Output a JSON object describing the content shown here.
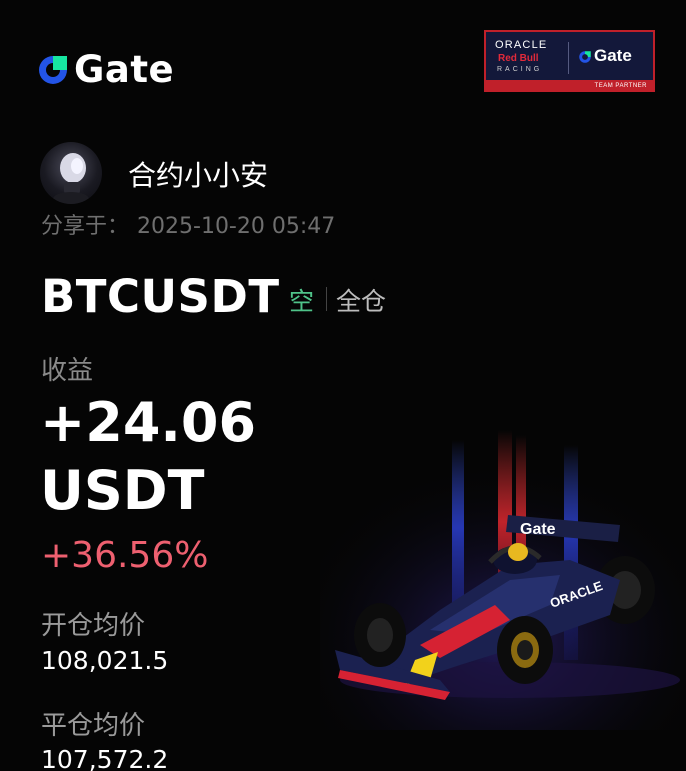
{
  "brand": {
    "logo_text": "Gate",
    "logo_icon": "gate-logo-icon",
    "accent_color": "#2354e6",
    "accent_green": "#17e6a1"
  },
  "partner_badge": {
    "oracle": "ORACLE",
    "red_bull": "Red Bull",
    "racing": "RACING",
    "gate": "Gate",
    "team_partner": "TEAM PARTNER"
  },
  "user": {
    "name": "合约小小安",
    "share_label": "分享于：",
    "share_time": "2025-10-20 05:47"
  },
  "position": {
    "pair": "BTCUSDT",
    "side": "空",
    "margin_mode": "全仓",
    "side_color": "#4fc389"
  },
  "pnl": {
    "label": "收益",
    "value": "+24.06",
    "unit": "USDT",
    "percent": "+36.56%",
    "percent_color": "#ee6070"
  },
  "prices": {
    "open_label": "开仓均价",
    "open_value": "108,021.5",
    "close_label": "平仓均价",
    "close_value": "107,572.2"
  }
}
